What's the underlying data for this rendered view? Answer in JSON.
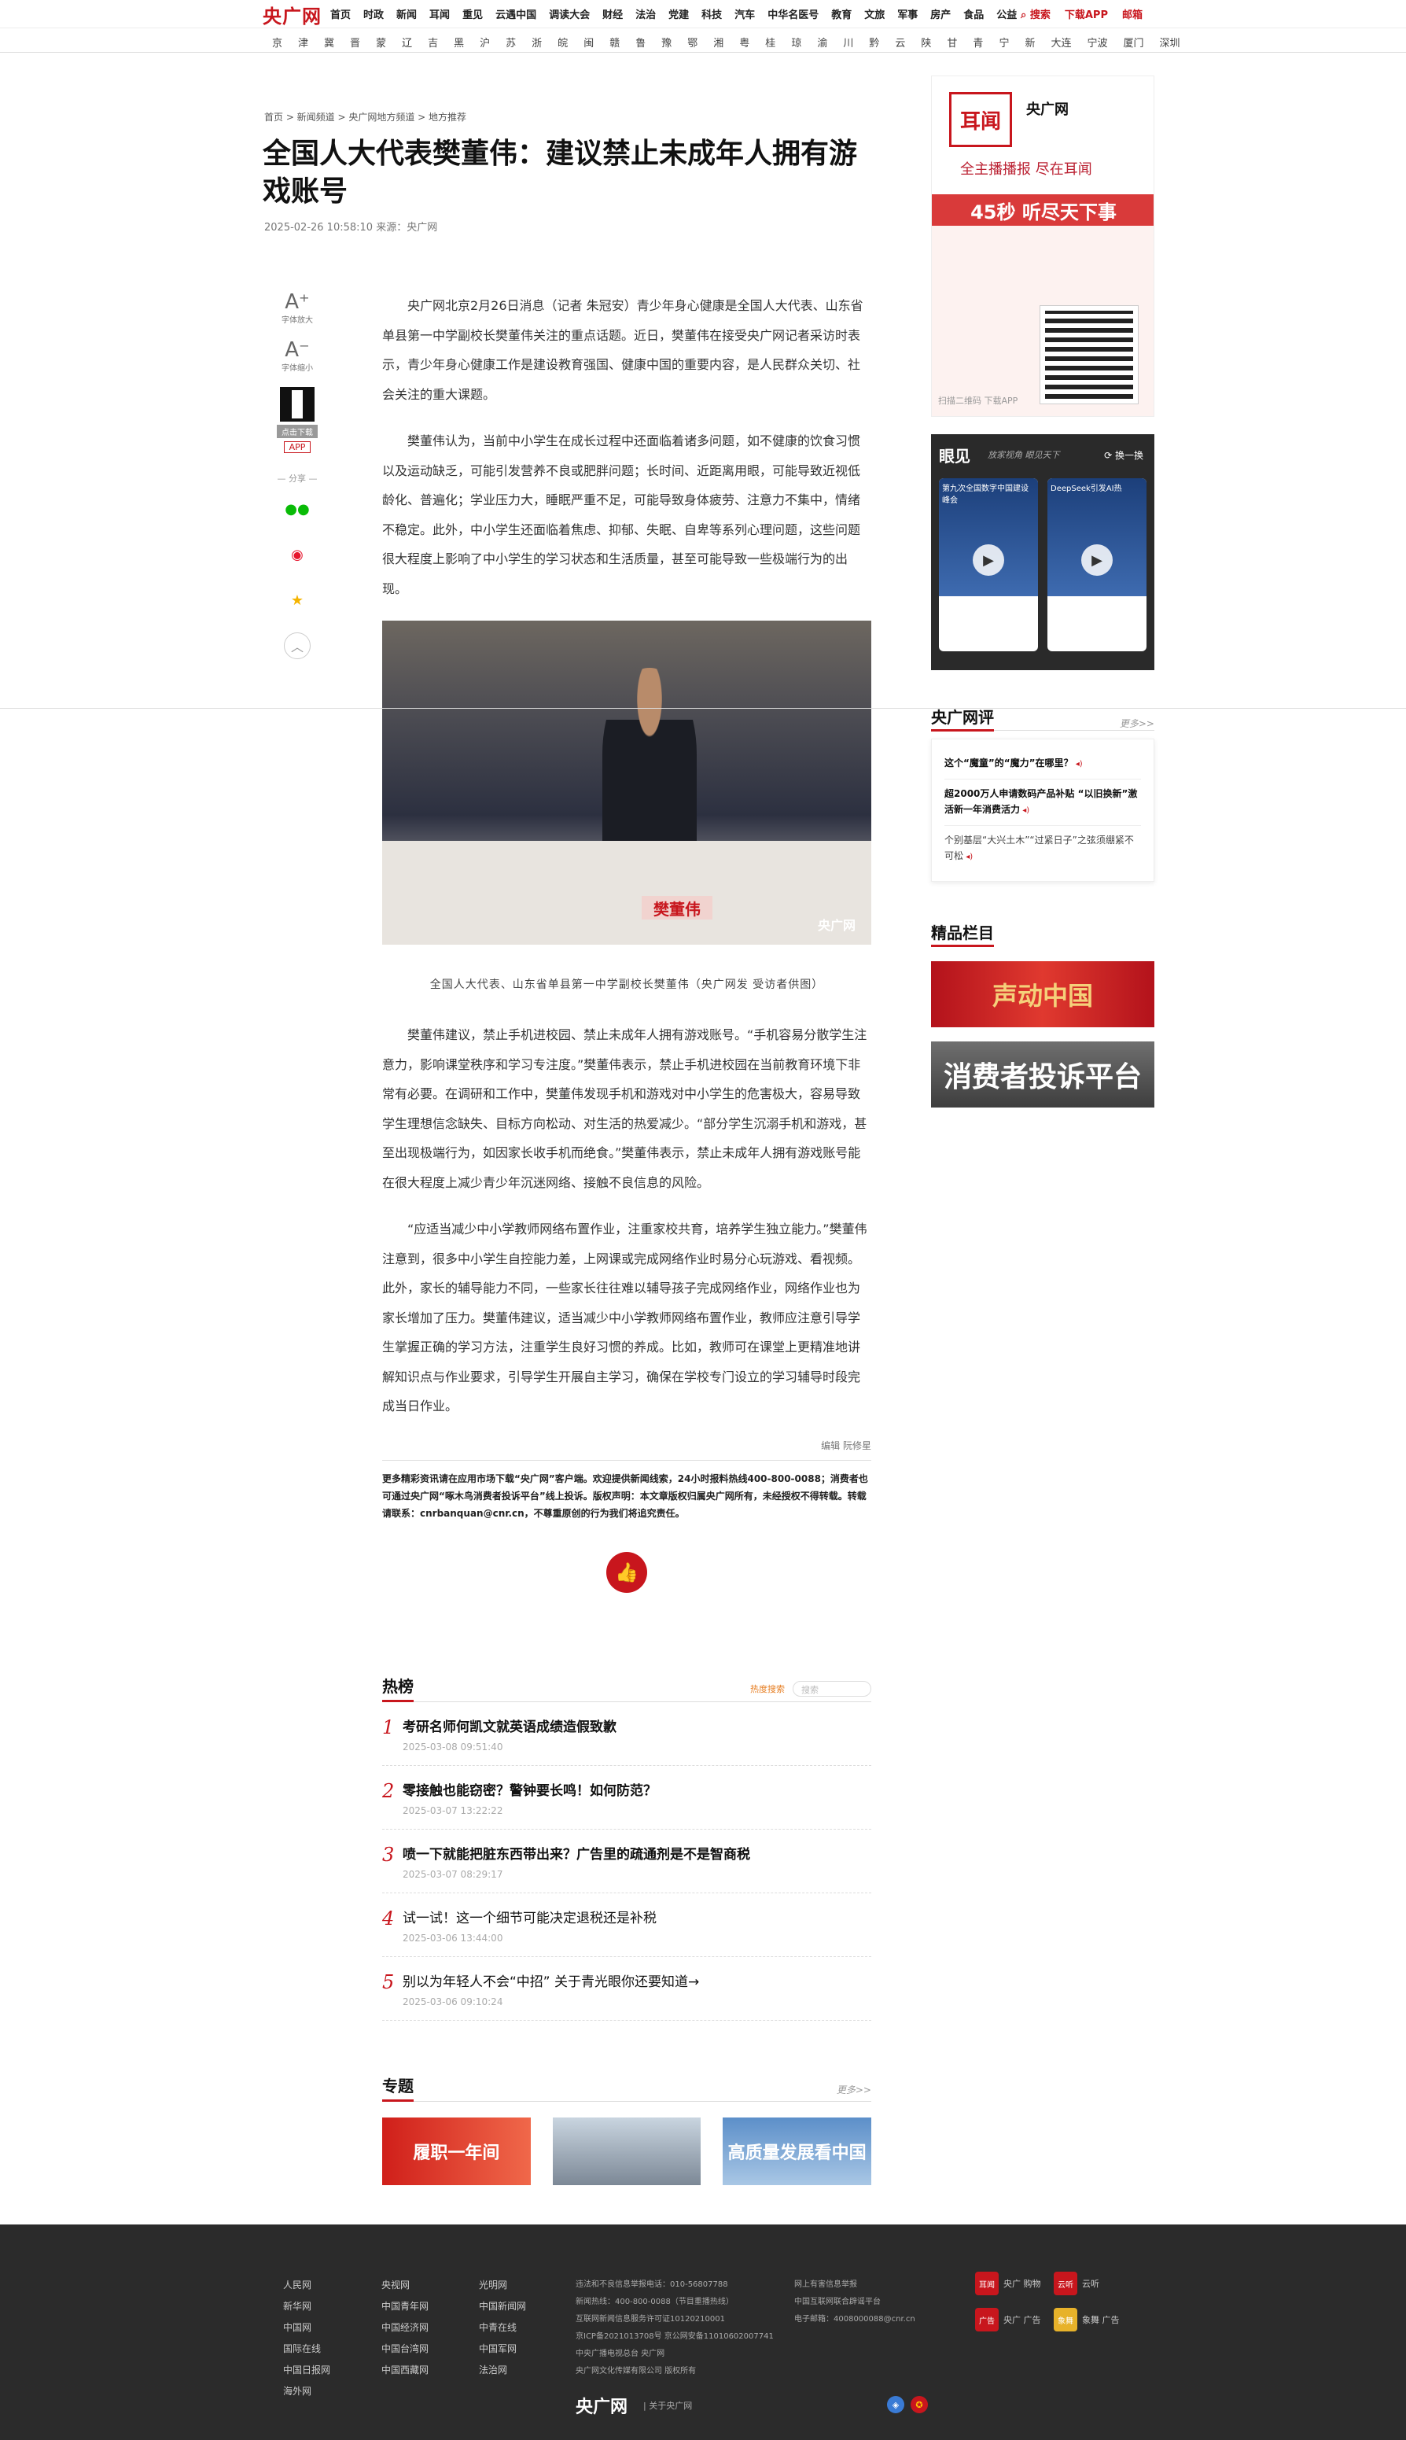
{
  "site": {
    "logo": "央广网"
  },
  "nav": {
    "items": [
      "首页",
      "时政",
      "新闻",
      "耳闻",
      "重见",
      "云遇中国",
      "调读大会",
      "财经",
      "法治",
      "党建",
      "科技",
      "汽车",
      "中华名医号",
      "教育",
      "文旅",
      "军事",
      "房产",
      "食品",
      "公益"
    ],
    "search": "搜索",
    "download": "下载APP",
    "mail": "邮箱"
  },
  "provinces": [
    "京",
    "津",
    "冀",
    "晋",
    "蒙",
    "辽",
    "吉",
    "黑",
    "沪",
    "苏",
    "浙",
    "皖",
    "闽",
    "赣",
    "鲁",
    "豫",
    "鄂",
    "湘",
    "粤",
    "桂",
    "琼",
    "渝",
    "川",
    "黔",
    "云",
    "陕",
    "甘",
    "青",
    "宁",
    "新",
    "大连",
    "宁波",
    "厦门",
    "深圳"
  ],
  "breadcrumb": "首页 > 新闻频道 > 央广网地方频道 > 地方推荐",
  "article": {
    "title": "全国人大代表樊董伟：建议禁止未成年人拥有游戏账号",
    "meta": "2025-02-26 10:58:10  来源：央广网",
    "p1": "央广网北京2月26日消息（记者 朱冠安）青少年身心健康是全国人大代表、山东省单县第一中学副校长樊董伟关注的重点话题。近日，樊董伟在接受央广网记者采访时表示，青少年身心健康工作是建设教育强国、健康中国的重要内容，是人民群众关切、社会关注的重大课题。",
    "p2": "樊董伟认为，当前中小学生在成长过程中还面临着诸多问题，如不健康的饮食习惯以及运动缺乏，可能引发营养不良或肥胖问题；长时间、近距离用眼，可能导致近视低龄化、普遍化；学业压力大，睡眠严重不足，可能导致身体疲劳、注意力不集中，情绪不稳定。此外，中小学生还面临着焦虑、抑郁、失眠、自卑等系列心理问题，这些问题很大程度上影响了中小学生的学习状态和生活质量，甚至可能导致一些极端行为的出现。",
    "photo_plate": "樊董伟",
    "photo_watermark": "央广网",
    "caption": "全国人大代表、山东省单县第一中学副校长樊董伟（央广网发 受访者供图）",
    "p3": "樊董伟建议，禁止手机进校园、禁止未成年人拥有游戏账号。“手机容易分散学生注意力，影响课堂秩序和学习专注度。”樊董伟表示，禁止手机进校园在当前教育环境下非常有必要。在调研和工作中，樊董伟发现手机和游戏对中小学生的危害极大，容易导致学生理想信念缺失、目标方向松动、对生活的热爱减少。“部分学生沉溺手机和游戏，甚至出现极端行为，如因家长收手机而绝食。”樊董伟表示，禁止未成年人拥有游戏账号能在很大程度上减少青少年沉迷网络、接触不良信息的风险。",
    "p4": "“应适当减少中小学教师网络布置作业，注重家校共育，培养学生独立能力。”樊董伟注意到，很多中小学生自控能力差，上网课或完成网络作业时易分心玩游戏、看视频。此外，家长的辅导能力不同，一些家长往往难以辅导孩子完成网络作业，网络作业也为家长增加了压力。樊董伟建议，适当减少中小学教师网络布置作业，教师应注意引导学生掌握正确的学习方法，注重学生良好习惯的养成。比如，教师可在课堂上更精准地讲解知识点与作业要求，引导学生开展自主学习，确保在学校专门设立的学习辅导时段完成当日作业。",
    "editor": "编辑 阮修星",
    "notice": "更多精彩资讯请在应用市场下载“央广网”客户端。欢迎提供新闻线索，24小时报料热线400-800-0088；消费者也可通过央广网“啄木鸟消费者投诉平台”线上投诉。版权声明：本文章版权归属央广网所有，未经授权不得转载。转载请联系：cnrbanquan@cnr.cn，不尊重原创的行为我们将追究责任。"
  },
  "tools": {
    "font_up": "字体放大",
    "font_down": "字体缩小",
    "download": "点击下载",
    "app": "APP",
    "share": "分享"
  },
  "hot": {
    "title": "热榜",
    "search_label": "热度搜索",
    "search_placeholder": "搜索",
    "items": [
      {
        "n": "1",
        "t": "考研名师何凯文就英语成绩造假致歉",
        "d": "2025-03-08 09:51:40"
      },
      {
        "n": "2",
        "t": "零接触也能窃密？警钟要长鸣！如何防范？",
        "d": "2025-03-07 13:22:22"
      },
      {
        "n": "3",
        "t": "喷一下就能把脏东西带出来？广告里的疏通剂是不是智商税",
        "d": "2025-03-07 08:29:17"
      },
      {
        "n": "4",
        "t": "试一试！这一个细节可能决定退税还是补税",
        "d": "2025-03-06 13:44:00"
      },
      {
        "n": "5",
        "t": "别以为年轻人不会“中招” 关于青光眼你还要知道→",
        "d": "2025-03-06 09:10:24"
      }
    ]
  },
  "topics": {
    "title": "专题",
    "more": "更多>>",
    "items": [
      "履职一年间",
      "",
      "高质量发展看中国"
    ]
  },
  "ad": {
    "logo": "耳闻",
    "app": "央广网",
    "slogan": "全主播播报 尽在耳闻",
    "band": "45秒 听尽天下事",
    "scan": "扫描二维码 下载APP"
  },
  "yanjian": {
    "title": "眼见",
    "sub": "放家视角 眼见天下",
    "switch": "换一换",
    "cards": [
      "第九次全国数字中国建设峰会",
      "DeepSeek引发AI热"
    ]
  },
  "ping": {
    "title": "央广网评",
    "more": "更多>>",
    "items": [
      "这个“魔童”的“魔力”在哪里？",
      "超2000万人申请数码产品补贴 “以旧换新”激活新一年消费活力",
      "个别基层“大兴土木”“过紧日子”之弦须绷紧不可松"
    ]
  },
  "jingpin": {
    "title": "精品栏目",
    "b1": "声动中国",
    "b2": "消费者投诉平台"
  },
  "footer": {
    "col1": [
      "人民网",
      "新华网",
      "中国网",
      "国际在线",
      "中国日报网",
      "海外网"
    ],
    "col2": [
      "央视网",
      "中国青年网",
      "中国经济网",
      "中国台湾网",
      "中国西藏网"
    ],
    "col3": [
      "光明网",
      "中国新闻网",
      "中青在线",
      "中国军网",
      "法治网"
    ],
    "info": [
      "违法和不良信息举报电话：010-56807788",
      "新闻热线：400-800-0088（节目重播热线）",
      "互联网新闻信息服务许可证10120210001",
      "京ICP备2021013708号 京公网安备11010602007741",
      "中央广播电视总台 央广网",
      "央广网文化传媒有限公司 版权所有"
    ],
    "info2": [
      "网上有害信息举报",
      "中国互联网联合辟谣平台",
      "电子邮箱：4008000088@cnr.cn"
    ],
    "apps": [
      {
        "ic": "耳闻",
        "lb": "央广 购物"
      },
      {
        "ic": "云听",
        "lb": "云听"
      },
      {
        "ic": "广告",
        "lb": "央广 广告"
      },
      {
        "ic": "象舞",
        "lb": "象舞 广告"
      }
    ],
    "logo": "央广网",
    "about": "| 关于央广网"
  }
}
